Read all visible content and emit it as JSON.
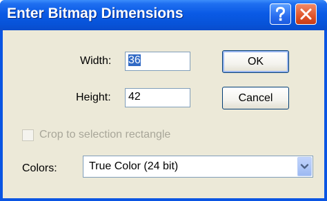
{
  "window": {
    "title": "Enter Bitmap Dimensions",
    "help_icon": "help-question-icon",
    "close_icon": "close-x-icon"
  },
  "form": {
    "width_label": "Width:",
    "width_value": "36",
    "height_label": "Height:",
    "height_value": "42",
    "crop_label": "Crop to selection rectangle",
    "crop_checked": false,
    "crop_enabled": false,
    "colors_label": "Colors:",
    "colors_value": "True Color (24 bit)",
    "dropdown_icon": "chevron-down-icon"
  },
  "buttons": {
    "ok_label": "OK",
    "cancel_label": "Cancel"
  },
  "colors": {
    "title_bar": "#0a5ae5",
    "dialog_face": "#ece9d8",
    "selection": "#316ac5",
    "close_button": "#e0542a"
  }
}
